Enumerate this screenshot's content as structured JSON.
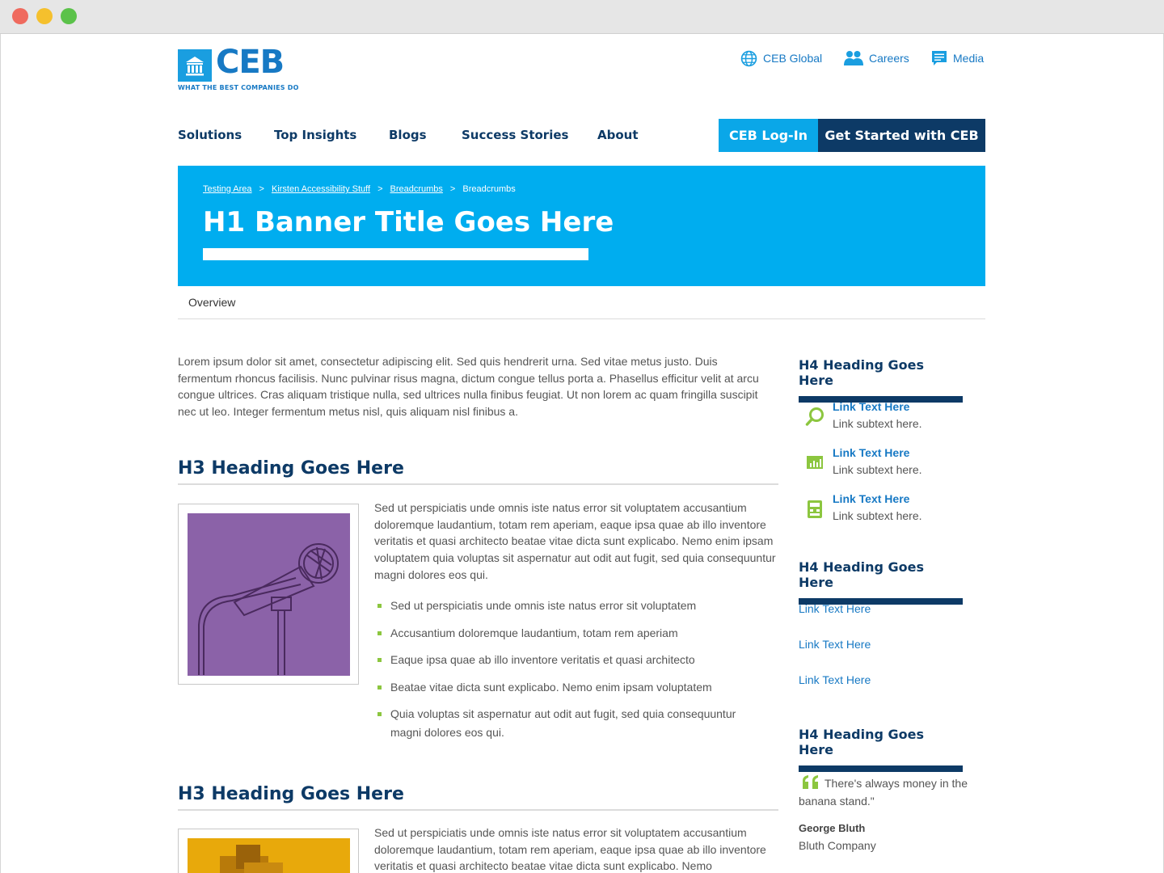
{
  "brand": {
    "name": "CEB",
    "tagline": "WHAT THE BEST COMPANIES DO"
  },
  "utility_nav": [
    {
      "label": "CEB Global",
      "icon": "globe-icon"
    },
    {
      "label": "Careers",
      "icon": "people-icon"
    },
    {
      "label": "Media",
      "icon": "chat-bubble-icon"
    }
  ],
  "main_nav": [
    "Solutions",
    "Top Insights",
    "Blogs",
    "Success Stories",
    "About"
  ],
  "buttons": {
    "login": "CEB Log-In",
    "get_started": "Get Started with CEB"
  },
  "banner": {
    "breadcrumbs": [
      "Testing Area",
      "Kirsten Accessibility Stuff",
      "Breadcrumbs",
      "Breadcrumbs"
    ],
    "separator": ">",
    "title": "H1 Banner Title Goes Here"
  },
  "tabs": [
    "Overview"
  ],
  "intro": "Lorem ipsum dolor sit amet, consectetur adipiscing elit. Sed quis hendrerit urna. Sed vitae metus justo. Duis fermentum rhoncus facilisis. Nunc pulvinar risus magna, dictum congue tellus porta a. Phasellus efficitur velit at arcu congue ultrices. Cras aliquam tristique nulla, sed ultrices nulla finibus feugiat. Ut non lorem ac quam fringilla suscipit nec ut leo. Integer fermentum metus nisl, quis aliquam nisl finibus a.",
  "sections": [
    {
      "heading": "H3 Heading Goes Here",
      "image": "microphone-image",
      "paragraph": "Sed ut perspiciatis unde omnis iste natus error sit voluptatem accusantium doloremque laudantium, totam rem aperiam, eaque ipsa quae ab illo inventore veritatis et quasi architecto beatae vitae dicta sunt explicabo. Nemo enim ipsam voluptatem quia voluptas sit aspernatur aut odit aut fugit, sed quia consequuntur magni dolores eos qui.",
      "bullets": [
        "Sed ut perspiciatis unde omnis iste natus error sit voluptatem",
        "Accusantium doloremque laudantium, totam rem aperiam",
        "Eaque ipsa quae ab illo inventore veritatis et quasi architecto",
        "Beatae vitae dicta sunt explicabo. Nemo enim ipsam voluptatem",
        "Quia voluptas sit aspernatur aut odit aut fugit, sed quia consequuntur magni dolores eos qui."
      ]
    },
    {
      "heading": "H3 Heading Goes Here",
      "image": "wood-blocks-image",
      "paragraph": "Sed ut perspiciatis unde omnis iste natus error sit voluptatem accusantium doloremque laudantium, totam rem aperiam, eaque ipsa quae ab illo inventore veritatis et quasi architecto beatae vitae dicta sunt explicabo. Nemo"
    }
  ],
  "sidebar": {
    "block1": {
      "heading": "H4 Heading Goes Here",
      "items": [
        {
          "icon": "magnifier-icon",
          "link": "Link Text Here",
          "sub": "Link subtext here."
        },
        {
          "icon": "bar-chart-icon",
          "link": "Link Text Here",
          "sub": "Link subtext here."
        },
        {
          "icon": "calculator-icon",
          "link": "Link Text Here",
          "sub": "Link subtext here."
        }
      ]
    },
    "block2": {
      "heading": "H4 Heading Goes Here",
      "links": [
        "Link Text Here",
        "Link Text Here",
        "Link Text Here"
      ]
    },
    "block3": {
      "heading": "H4 Heading Goes Here",
      "quote": "There's always money in the banana stand.\"",
      "author": "George Bluth",
      "company": "Bluth Company"
    }
  },
  "colors": {
    "brand_blue": "#1779c4",
    "banner_blue": "#00adef",
    "navy": "#0d3a66",
    "accent_green": "#8cc63f",
    "image_purple": "#8b62a8",
    "image_yellow": "#e8a90b"
  }
}
